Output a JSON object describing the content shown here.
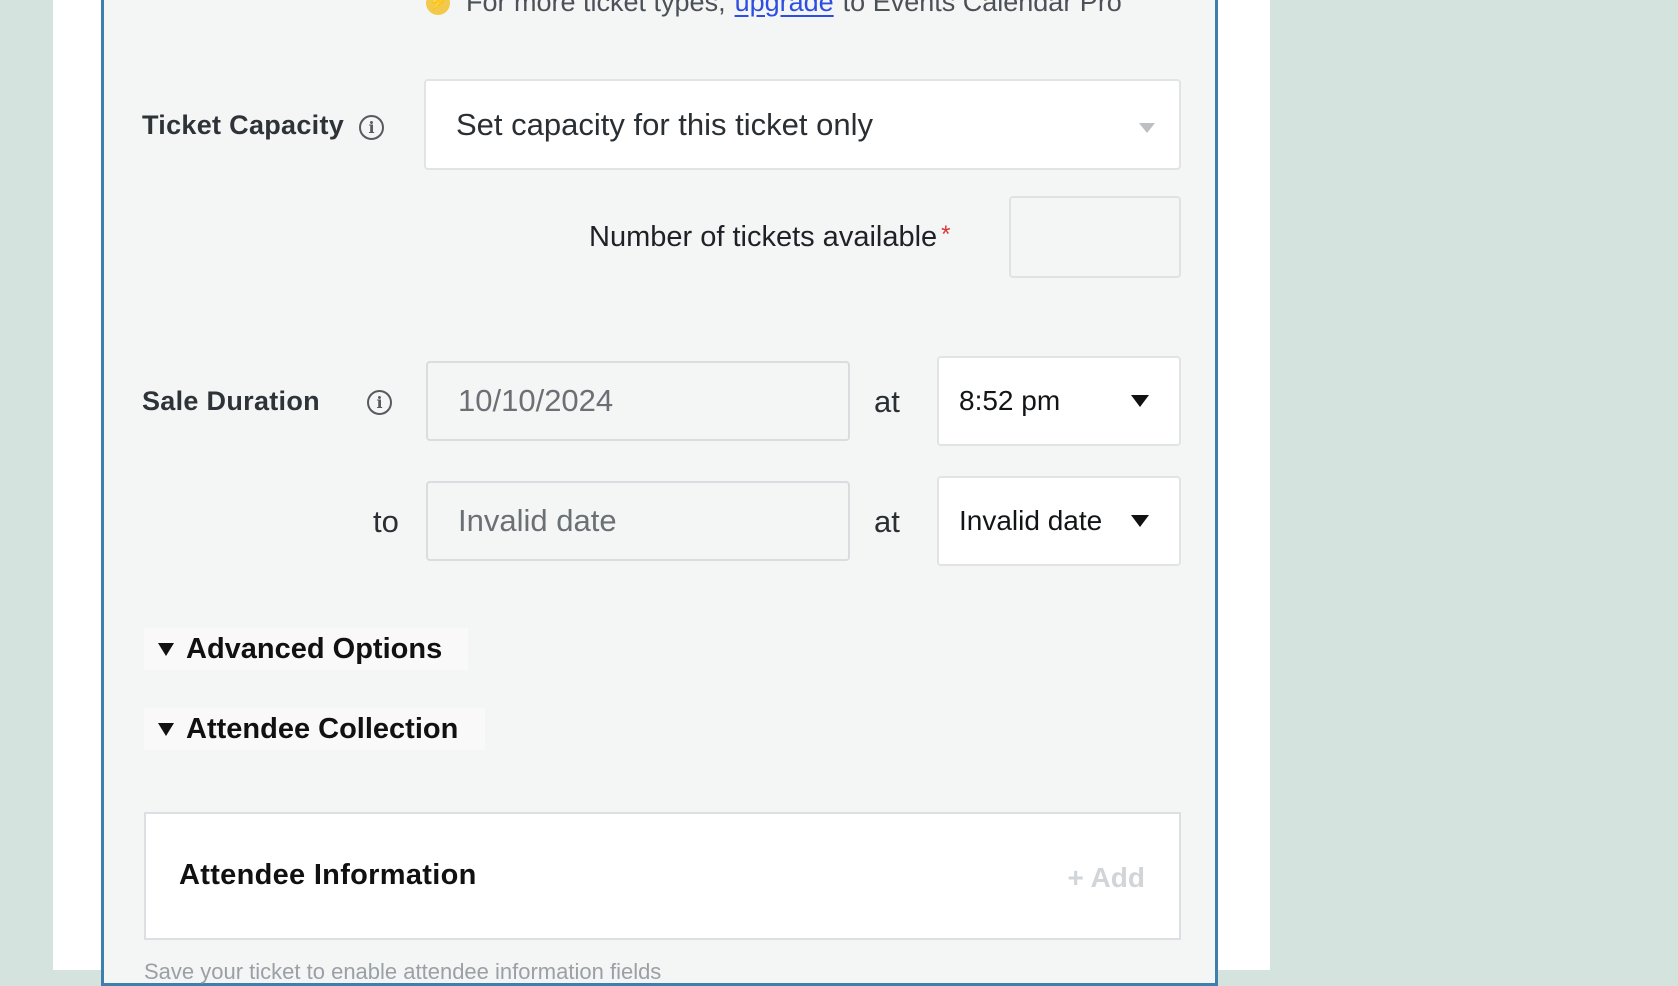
{
  "upgrade_notice": {
    "prefix": "For more ticket types,",
    "link": "upgrade",
    "suffix": "to Events Calendar Pro"
  },
  "capacity": {
    "label": "Ticket Capacity",
    "selected_option": "Set capacity for this ticket only",
    "tickets_available_label": "Number of tickets available",
    "required_marker": "*",
    "tickets_available_value": ""
  },
  "sale_duration": {
    "label": "Sale Duration",
    "start_date": "10/10/2024",
    "start_at": "at",
    "start_time": "8:52 pm",
    "to_label": "to",
    "end_date": "Invalid date",
    "end_at": "at",
    "end_time": "Invalid date"
  },
  "sections": {
    "advanced_options": "Advanced Options",
    "attendee_collection": "Attendee Collection"
  },
  "attendee_information": {
    "title": "Attendee Information",
    "add_label": "+ Add",
    "help_text": "Save your ticket to enable attendee information fields"
  },
  "colors": {
    "page_background": "#d5e3de",
    "panel_border": "#3f7fae",
    "link": "#2d4ee0",
    "required": "#d63638"
  },
  "icons": {
    "upgrade": "lightning-bolt-icon",
    "info": "info-circle-icon",
    "dropdown": "caret-down-icon",
    "section_toggle": "triangle-down-icon"
  }
}
